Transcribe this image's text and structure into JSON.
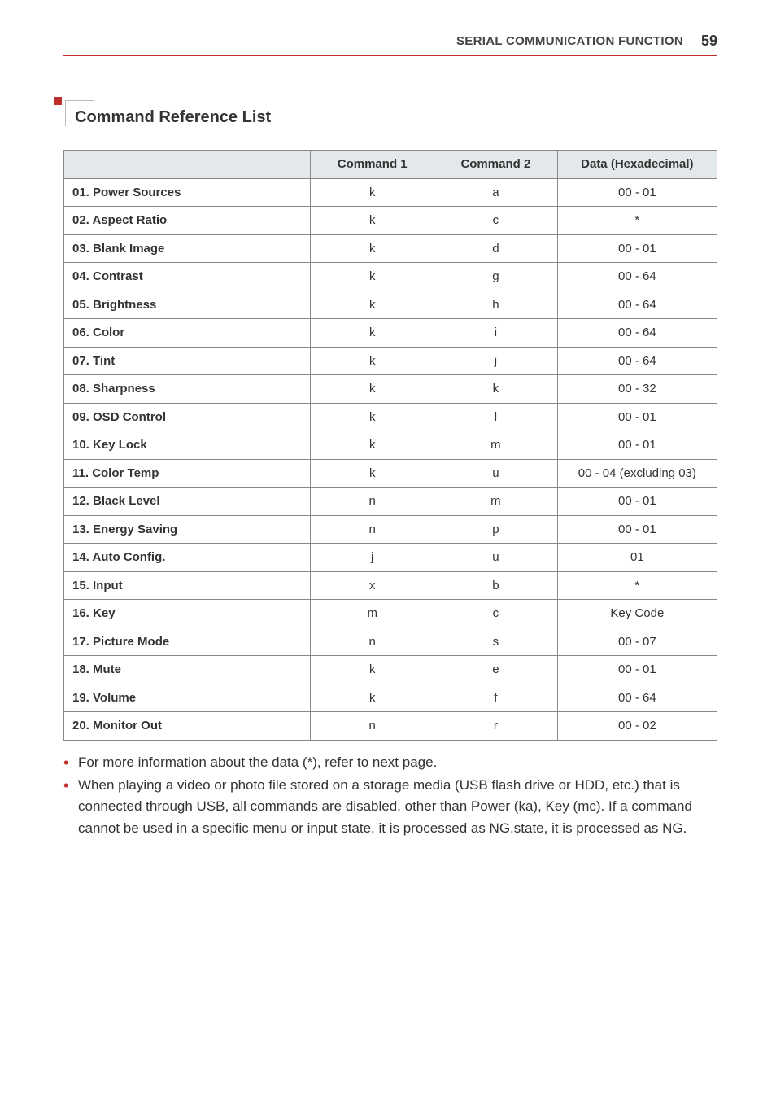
{
  "header": {
    "section_title": "SERIAL COMMUNICATION FUNCTION",
    "page_number": "59"
  },
  "heading": "Command Reference List",
  "table": {
    "headers": [
      "",
      "Command 1",
      "Command 2",
      "Data (Hexadecimal)"
    ],
    "rows": [
      {
        "label": "01. Power Sources",
        "c1": "k",
        "c2": "a",
        "c3": "00 - 01"
      },
      {
        "label": "02. Aspect Ratio",
        "c1": "k",
        "c2": "c",
        "c3": "*"
      },
      {
        "label": "03. Blank Image",
        "c1": "k",
        "c2": "d",
        "c3": "00 - 01"
      },
      {
        "label": "04. Contrast",
        "c1": "k",
        "c2": "g",
        "c3": "00 - 64"
      },
      {
        "label": "05. Brightness",
        "c1": "k",
        "c2": "h",
        "c3": "00 - 64"
      },
      {
        "label": "06. Color",
        "c1": "k",
        "c2": "i",
        "c3": "00 - 64"
      },
      {
        "label": "07. Tint",
        "c1": "k",
        "c2": "j",
        "c3": "00 - 64"
      },
      {
        "label": "08. Sharpness",
        "c1": "k",
        "c2": "k",
        "c3": "00 - 32"
      },
      {
        "label": "09. OSD Control",
        "c1": "k",
        "c2": "l",
        "c3": "00 - 01"
      },
      {
        "label": "10. Key Lock",
        "c1": "k",
        "c2": "m",
        "c3": "00 - 01"
      },
      {
        "label": "11. Color Temp",
        "c1": "k",
        "c2": "u",
        "c3": "00 - 04 (excluding 03)"
      },
      {
        "label": "12. Black Level",
        "c1": "n",
        "c2": "m",
        "c3": "00 - 01"
      },
      {
        "label": "13. Energy Saving",
        "c1": "n",
        "c2": "p",
        "c3": "00 - 01"
      },
      {
        "label": "14. Auto Config.",
        "c1": "j",
        "c2": "u",
        "c3": "01"
      },
      {
        "label": "15. Input",
        "c1": "x",
        "c2": "b",
        "c3": "*"
      },
      {
        "label": "16. Key",
        "c1": "m",
        "c2": "c",
        "c3": "Key Code"
      },
      {
        "label": "17. Picture Mode",
        "c1": "n",
        "c2": "s",
        "c3": "00 - 07"
      },
      {
        "label": "18. Mute",
        "c1": "k",
        "c2": "e",
        "c3": "00 - 01"
      },
      {
        "label": "19. Volume",
        "c1": "k",
        "c2": "f",
        "c3": "00 - 64"
      },
      {
        "label": "20. Monitor Out",
        "c1": "n",
        "c2": "r",
        "c3": "00 - 02"
      }
    ]
  },
  "bullets": [
    "For more information about the data (*), refer to next page.",
    "When playing a video or photo file stored on a storage media (USB flash drive or HDD, etc.) that is connected through USB, all commands are disabled, other than Power (ka), Key (mc). If a command cannot be used in a specific menu or input state, it is processed as NG.state, it is processed as NG."
  ]
}
